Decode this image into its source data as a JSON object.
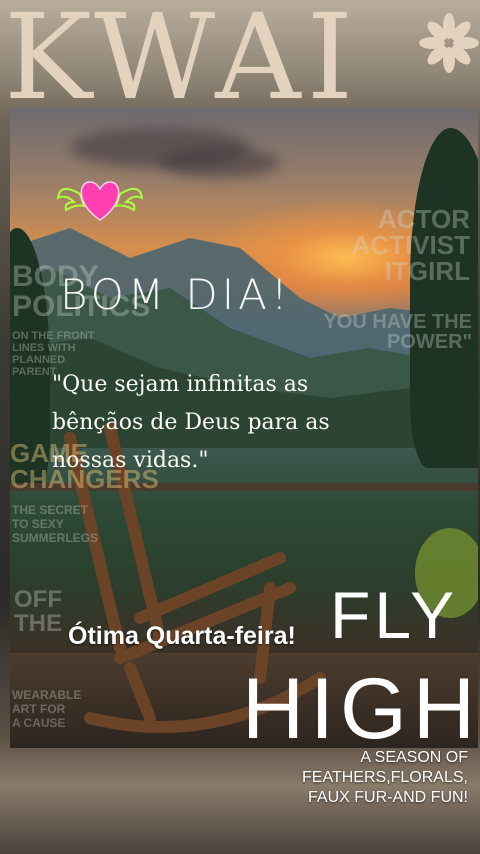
{
  "magazine": {
    "logo": "KWAI",
    "logo_mark": "*-icon"
  },
  "greeting": {
    "title": "BOM DIA!",
    "quote": "\"Que sejam infinitas as bênçãos de Deus para as nossas vidas.\"",
    "weekday_wish": "Ótima Quarta-feira!"
  },
  "cover_lines": {
    "left_top": [
      "BODY",
      "POLITICS"
    ],
    "left_top_sub": [
      "ON THE FRONT",
      "LINES WITH",
      "PLANNED",
      "PARENT"
    ],
    "left_mid": [
      "GAME",
      "CHANGERS"
    ],
    "left_mid_sub": [
      "THE SECRET",
      "TO SEXY",
      "SUMMERLEGS"
    ],
    "left_bottom": [
      "OFF",
      "THE"
    ],
    "left_bottom_sub": [
      "WEARABLE",
      "ART FOR",
      "A CAUSE"
    ],
    "right_top": [
      "ACTOR",
      "ACTIVIST",
      "ITGIRL"
    ],
    "right_top_sub": [
      "YOU HAVE THE",
      "POWER\""
    ]
  },
  "headline": {
    "line1": "FLY",
    "line2": "HIGH",
    "sub": [
      "A SEASON OF",
      "FEATHERS,FLORALS,",
      "FAUX FUR-AND FUN!"
    ]
  },
  "colors": {
    "logo": "#e3d2bd",
    "heart": "#ff3fb0",
    "wings": "#a8ff3c",
    "text": "#ffffff"
  }
}
